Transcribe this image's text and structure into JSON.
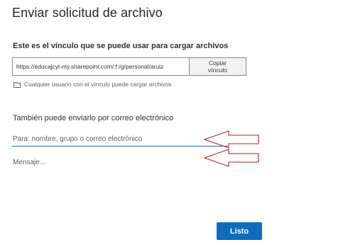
{
  "dialog": {
    "title": "Enviar solicitud de archivo"
  },
  "link_section": {
    "label": "Este es el vínculo que se puede usar para cargar archivos",
    "url": "https://educajcyl-my.sharepoint.com/:f:/g/personal/aruiz",
    "copy_button_line1": "Copiar",
    "copy_button_line2": "vínculo",
    "permission_icon": "folder-icon",
    "permission_text": "Cualquier usuario con el vínculo puede cargar archivos"
  },
  "email_section": {
    "label": "También puede enviarlo por correo electrónico",
    "to_placeholder": "Para: nombre, grupo o correo electrónico",
    "message_placeholder": "Mensaje..."
  },
  "annotations": {
    "arrow_color": "#b81c22"
  },
  "footer": {
    "done_label": "Listo"
  },
  "colors": {
    "accent": "#0f6cbd",
    "text": "#323130"
  }
}
